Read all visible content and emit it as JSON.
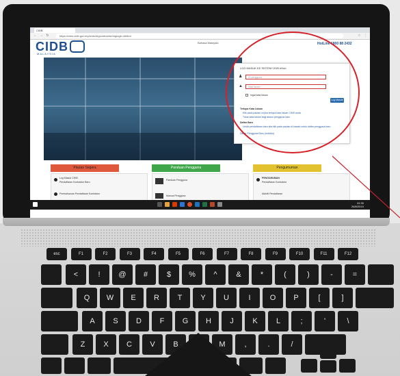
{
  "browser": {
    "tab_title": "CIDB",
    "url": "https://cims.cidb.gov.my/smis/regcontractor/reglogin.vbhtml"
  },
  "site": {
    "logo": "CIDB",
    "logo_sub": "MALAYSIA",
    "language": "Bahasa Malaysia",
    "hotline": "HotLine 1800 88 2432"
  },
  "login": {
    "title": "LOG MASUK KE SISTEM CIDB eHub",
    "username_placeholder": "ID pengguna",
    "password_placeholder": "Kata laluan",
    "remember_label": "Ingat kata laluan",
    "button": "Log Masuk",
    "forgot_heading": "Terlupa Kata Laluan",
    "forgot_items": [
      "Klik pada pautan ini jika terlupa kata laluan CIMS anda",
      "Tukar kata laluan bagi akaun pengguna baru"
    ],
    "new_heading": "Daftar Baru",
    "new_items": [
      "Untuk pendaftaran baru sila klik pada pautan di bawah untuk daftar pengguna baru"
    ],
    "footer_link": "Daftar Pengguna Baru (Individu)"
  },
  "sections": [
    {
      "label": "Pautan Segera",
      "color": "#e0583c"
    },
    {
      "label": "Panduan Pengguna",
      "color": "#3fa64a"
    },
    {
      "label": "Pengumuman",
      "color": "#e3c22f"
    }
  ],
  "cards": {
    "left": [
      "Log Masuk CIMS",
      "Pendaftaran Kontraktor Baru",
      "Pembaharuan Pendaftaran Kontraktor"
    ],
    "middle": [
      "Panduan Pengguna",
      "Manual Pengguna"
    ],
    "right": [
      "PENGUMUMAN",
      "Pendaftaran Kontraktor",
      "Aktiviti Pendaftaran"
    ]
  },
  "taskbar": {
    "time": "10:35",
    "date": "26/8/2019"
  },
  "keyboard": {
    "fn_row": [
      "esc",
      "F1",
      "F2",
      "F3",
      "F4",
      "F5",
      "F6",
      "F7",
      "F8",
      "F9",
      "F10",
      "F11",
      "F12"
    ],
    "number_row": [
      "<",
      "!",
      "@",
      "#",
      "$",
      "%",
      "^",
      "&",
      "*",
      "(",
      ")",
      "-",
      "="
    ],
    "top_row": [
      "Q",
      "W",
      "E",
      "R",
      "T",
      "Y",
      "U",
      "I",
      "O",
      "P",
      "[",
      "]"
    ],
    "home_row": [
      "A",
      "S",
      "D",
      "F",
      "G",
      "H",
      "J",
      "K",
      "L",
      ";",
      "'",
      "\\"
    ],
    "bottom_row": [
      "Z",
      "X",
      "C",
      "V",
      "B",
      "N",
      "M",
      ",",
      ".",
      "/"
    ]
  },
  "colors": {
    "highlight": "#d62028",
    "brand": "#1d4e8f"
  }
}
